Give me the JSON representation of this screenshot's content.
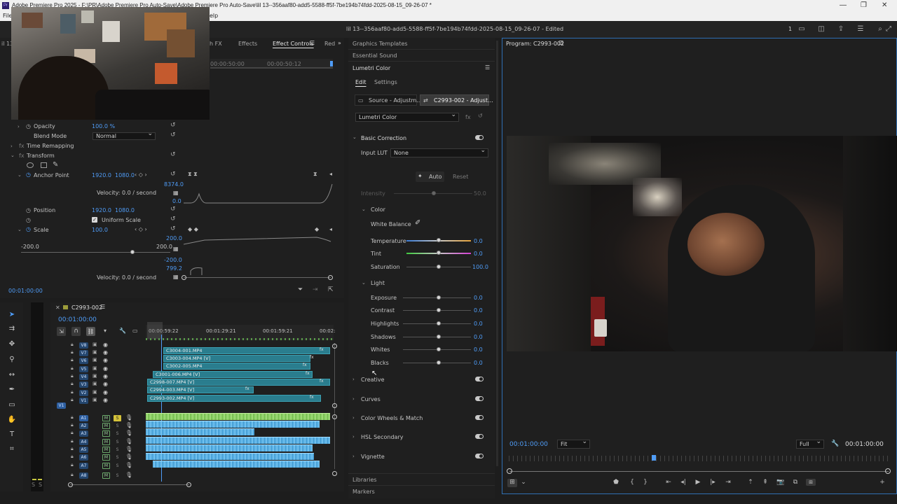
{
  "window": {
    "title": "Adobe Premiere Pro 2025 - F:\\PR\\Adobe Premiere Pro Auto-Save\\Adobe Premiere Pro Auto-Save\\lil 13--356aaf80-add5-5588-ff5f-7be194b74fdd-2025-08-15_09-26-07 *",
    "app_icon": "Pr"
  },
  "menu": {
    "file": "File",
    "help": "elp"
  },
  "header": {
    "doc_title": "lil 13--356aaf80-add5-5588-ff5f-7be194b74fdd-2025-08-15_09-26-07 - Edited",
    "count": "1"
  },
  "source_panel": {
    "tabs": [
      "h FX",
      "Effects",
      "Effect Controls",
      "Red"
    ],
    "active_tab": "Effect Controls",
    "left_tab_partial": "il 13",
    "timecode_a": "00:00:50:00",
    "timecode_b": "00:00:50:12"
  },
  "effect_controls": {
    "opacity_label": "Opacity",
    "opacity_value": "100.0 %",
    "blend_label": "Blend Mode",
    "blend_value": "Normal",
    "time_remap": "Time Remapping",
    "transform": "Transform",
    "anchor_label": "Anchor Point",
    "anchor_x": "1920.0",
    "anchor_y": "1080.0",
    "graph_top": "8374.0",
    "graph_zero": "0.0",
    "velocity1": "Velocity: 0.0 / second",
    "position_label": "Position",
    "position_x": "1920.0",
    "position_y": "1080.0",
    "uniform_scale": "Uniform Scale",
    "scale_label": "Scale",
    "scale_value": "100.0",
    "scale_min": "-200.0",
    "scale_max": "200.0",
    "scale_graph_top": "200.0",
    "scale_graph_bottom": "-200.0",
    "scale_graph_799": "799.2",
    "velocity2": "Velocity: 0.0 / second",
    "current_time": "00:01:00:00"
  },
  "timeline": {
    "sequence_name": "C2993-002",
    "timecode": "00:01:00:00",
    "ruler": [
      "00:00:59:22",
      "00:01:29:21",
      "00:01:59:21",
      "00:02:"
    ],
    "video_tracks": [
      "V8",
      "V7",
      "V6",
      "V5",
      "V4",
      "V3",
      "V2",
      "V1"
    ],
    "audio_tracks": [
      "A1",
      "A2",
      "A3",
      "A4",
      "A5",
      "A6",
      "A7",
      "A8"
    ],
    "source_patch_v": "V1",
    "m_label": "M",
    "s_label": "S",
    "clips": [
      "C3004-001.MP4",
      "C3003-004.MP4 [V]",
      "C3002-005.MP4",
      "C3001-006.MP4 [V]",
      "C2998-007.MP4 [V]",
      "C2994-003.MP4 [V]",
      "C2993-002.MP4 [V]"
    ],
    "fx_label": "fx"
  },
  "lumetri": {
    "tab_graphics": "Graphics Templates",
    "tab_sound": "Essential Sound",
    "panel_title": "Lumetri Color",
    "tab_edit": "Edit",
    "tab_settings": "Settings",
    "source_btn": "Source - Adjustm...",
    "target_btn": "C2993-002 - Adjust...",
    "effect_select": "Lumetri Color",
    "basic_correction": "Basic Correction",
    "input_lut_label": "Input LUT",
    "input_lut_value": "None",
    "auto": "Auto",
    "reset": "Reset",
    "intensity_label": "Intensity",
    "intensity_value": "50.0",
    "color_section": "Color",
    "white_balance": "White Balance",
    "temperature_label": "Temperature",
    "temperature_value": "0.0",
    "tint_label": "Tint",
    "tint_value": "0.0",
    "saturation_label": "Saturation",
    "saturation_value": "100.0",
    "light_section": "Light",
    "exposure_label": "Exposure",
    "exposure_value": "0.0",
    "contrast_label": "Contrast",
    "contrast_value": "0.0",
    "highlights_label": "Highlights",
    "highlights_value": "0.0",
    "shadows_label": "Shadows",
    "shadows_value": "0.0",
    "whites_label": "Whites",
    "whites_value": "0.0",
    "blacks_label": "Blacks",
    "blacks_value": "0.0",
    "creative": "Creative",
    "curves": "Curves",
    "color_wheels": "Color Wheels & Match",
    "hsl": "HSL Secondary",
    "vignette": "Vignette",
    "libraries": "Libraries",
    "markers": "Markers"
  },
  "program": {
    "title": "Program: C2993-002",
    "timecode_left": "00:01:00:00",
    "fit": "Fit",
    "quality": "Full",
    "timecode_right": "00:01:00:00"
  },
  "colors": {
    "accent_blue": "#4f9cf7",
    "clip_teal": "#2a7d8e",
    "audio_blue": "#5db3e6",
    "audio_green": "#8fd16a"
  }
}
